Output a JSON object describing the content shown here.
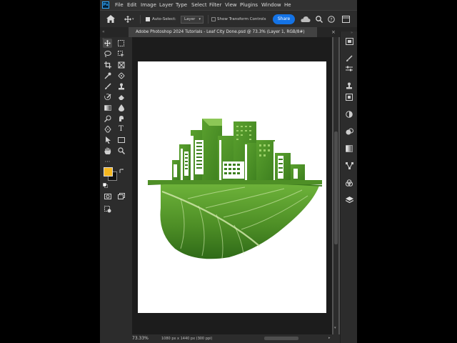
{
  "app": {
    "logo_text": "Ps"
  },
  "menu": [
    "File",
    "Edit",
    "Image",
    "Layer",
    "Type",
    "Select",
    "Filter",
    "View",
    "Plugins",
    "Window",
    "He"
  ],
  "options": {
    "auto_select_label": "Auto-Select:",
    "auto_select_checked": true,
    "layer_select": "Layer",
    "transform_label": "Show Transform Controls",
    "transform_checked": false,
    "share_label": "Share"
  },
  "document_tab": {
    "title": "Adobe Photoshop 2024 Tutorials - Leaf City Done.psd @ 73.3% (Layer 1, RGB/8#)"
  },
  "status": {
    "zoom": "73.33%",
    "doc_info": "1080 px x 1440 px (300 ppi)"
  },
  "colors": {
    "foreground": "#f5b71f",
    "background": "#111111",
    "accent": "#1473e6",
    "leaf": "#4e8f26"
  }
}
